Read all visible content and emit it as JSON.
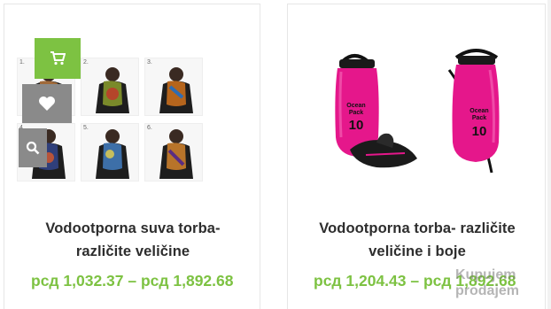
{
  "products": [
    {
      "title_line1": "Vodootporna suva torba-",
      "title_line2": "različite veličine",
      "price_range": "рсд 1,032.37 – рсд 1,892.68",
      "thumbnail_labels": [
        "1.",
        "2.",
        "3.",
        "4.",
        "5.",
        "6."
      ],
      "actions": {
        "cart_icon": "cart-icon",
        "wishlist_icon": "heart-icon",
        "search_icon": "search-icon"
      }
    },
    {
      "title_line1": "Vodootporna torba- različite",
      "title_line2": "veličine i boje",
      "price_range": "рсд 1,204.43 – рсд 1,892.68",
      "image_text": {
        "bag_left_line1": "Ocean",
        "bag_left_line2": "Pack",
        "bag_left_size": "10",
        "bag_right_line1": "Ocean",
        "bag_right_line2": "Pack",
        "bag_right_size": "10"
      }
    }
  ],
  "watermark": {
    "line1": "Kupujem",
    "line2": "prodajem"
  },
  "colors": {
    "accent_green": "#7dc242",
    "icon_gray": "#8a8a8a",
    "bag_pink": "#e5178b"
  }
}
